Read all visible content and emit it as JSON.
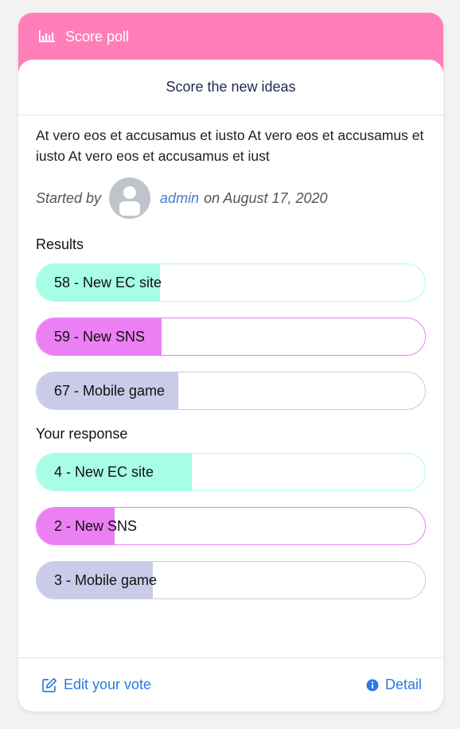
{
  "poll": {
    "header_title": "Score poll",
    "title": "Score the new ideas",
    "description": "At vero eos et accusamus et iusto At vero eos et accusamus et iusto At vero eos et accusamus et iust",
    "started_by_label": "Started by",
    "author": "admin",
    "date_text": "on August 17, 2020"
  },
  "results": {
    "label": "Results",
    "items": [
      {
        "text": "58 - New EC site",
        "fraction": 0.318,
        "fill": "#a8fde6",
        "border": "#a8fde6"
      },
      {
        "text": "59 - New SNS",
        "fraction": 0.321,
        "fill": "#eb80f5",
        "border": "#eb80f5"
      },
      {
        "text": "67 - Mobile game",
        "fraction": 0.364,
        "fill": "#c9cbe8",
        "border": "#c9cbe8"
      }
    ]
  },
  "response": {
    "label": "Your response",
    "items": [
      {
        "text": "4 - New EC site",
        "fraction": 0.4,
        "fill": "#a8fde6",
        "border": "#a8fde6"
      },
      {
        "text": "2 - New SNS",
        "fraction": 0.2,
        "fill": "#eb80f5",
        "border": "#eb80f5"
      },
      {
        "text": "3 - Mobile game",
        "fraction": 0.3,
        "fill": "#c9cbe8",
        "border": "#c9cbe8"
      }
    ]
  },
  "footer": {
    "edit_label": "Edit your vote",
    "detail_label": "Detail"
  },
  "colors": {
    "header": "#ff7eb9",
    "link": "#2a7ae2"
  },
  "icons": {
    "header": "bar-chart-icon",
    "edit": "edit-icon",
    "detail": "info-icon"
  }
}
